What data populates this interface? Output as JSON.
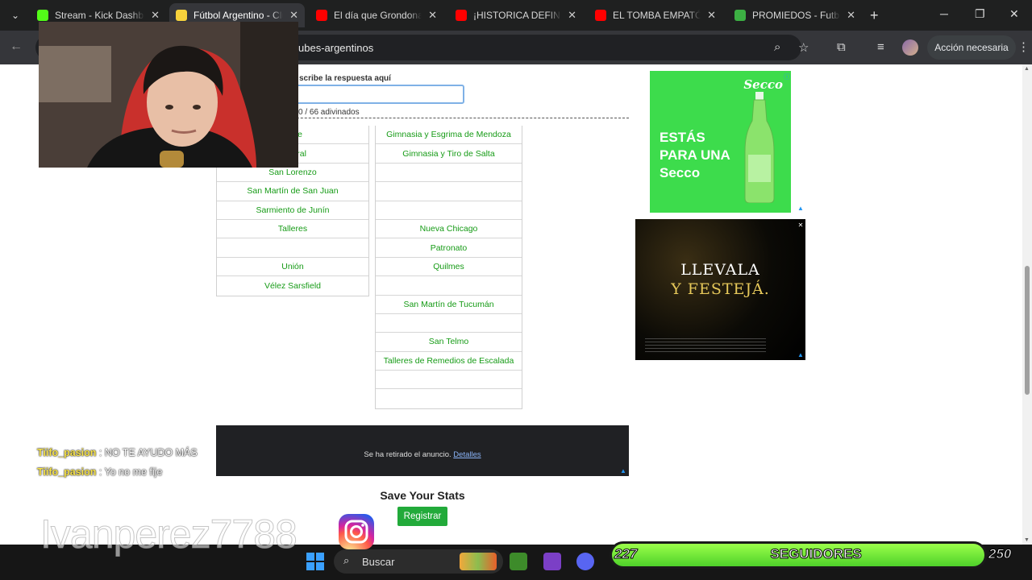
{
  "browser": {
    "tabs": [
      {
        "title": "Stream - Kick Dashboard",
        "favicon": "kick-icon",
        "color": "#53fc18",
        "active": false
      },
      {
        "title": "Fútbol Argentino - Clubes",
        "favicon": "sporcle-icon",
        "color": "#f7d23c",
        "active": true
      },
      {
        "title": "El día que Grondona",
        "favicon": "youtube-icon",
        "color": "#ff0000",
        "active": false
      },
      {
        "title": "¡HISTORICA DEFINICION",
        "favicon": "youtube-icon",
        "color": "#ff0000",
        "active": false
      },
      {
        "title": "EL TOMBA EMPATÓ C",
        "favicon": "youtube-icon",
        "color": "#ff0000",
        "active": false
      },
      {
        "title": "PROMIEDOS - Futbol",
        "favicon": "promiedos-icon",
        "color": "#3cb043",
        "active": false
      }
    ],
    "url_fragment": "ubes-argentinos",
    "action_button": "Acción necesaria"
  },
  "quiz": {
    "answer_label": "scribe la respuesta aquí",
    "answer_value": "",
    "progress": "0 / 66 adivinados",
    "columns": [
      [
        "Plate",
        "Central",
        "San Lorenzo",
        "San Martín de San Juan",
        "Sarmiento de Junín",
        "Talleres",
        "",
        "Unión",
        "Vélez Sarsfield"
      ],
      [
        "Gimnasia y Esgrima de Mendoza",
        "Gimnasia y Tiro de Salta",
        "",
        "",
        "",
        "Nueva Chicago",
        "Patronato",
        "Quilmes",
        "",
        "San Martín de Tucumán",
        "",
        "San Telmo",
        "Talleres de Remedios de Escalada",
        "",
        ""
      ]
    ]
  },
  "ads": {
    "green": {
      "brand": "Secco",
      "headline": "ESTÁS PARA UNA Secco",
      "color": "#3ddc4c"
    },
    "dark": {
      "line1": "LLEVALA",
      "line2": "Y FESTEJÁ."
    },
    "removed": {
      "text": "Se ha retirado el anuncio.",
      "link": "Detalles"
    }
  },
  "stats": {
    "title": "Save Your Stats",
    "button": "Registrar"
  },
  "stream": {
    "chat": [
      {
        "user": "Tiifo_pasion",
        "msg": "NO TE AYUDO MÁS"
      },
      {
        "user": "Tiifo_pasion",
        "msg": "Yo no me fije"
      }
    ],
    "watermark": "Ivanperez7788",
    "followers": {
      "current": "227",
      "label": "SEGUIDORES",
      "goal": "250"
    }
  },
  "taskbar": {
    "search_label": "Buscar"
  }
}
